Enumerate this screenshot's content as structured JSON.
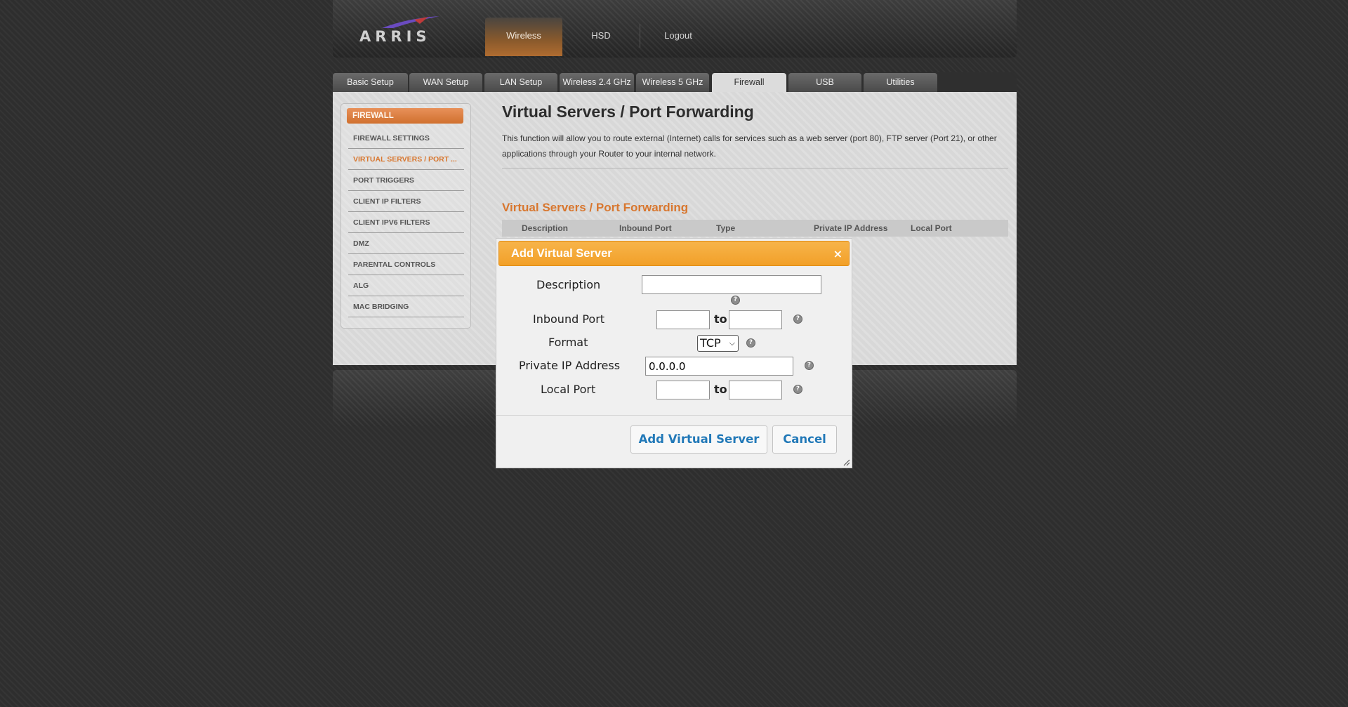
{
  "header": {
    "logo_text": "ARRIS",
    "nav": [
      {
        "label": "Wireless",
        "active": true
      },
      {
        "label": "HSD",
        "active": false
      },
      {
        "label": "Logout",
        "active": false
      }
    ]
  },
  "tabs": [
    {
      "label": "Basic Setup"
    },
    {
      "label": "WAN Setup"
    },
    {
      "label": "LAN Setup"
    },
    {
      "label": "Wireless 2.4 GHz"
    },
    {
      "label": "Wireless 5 GHz"
    },
    {
      "label": "Firewall",
      "active": true
    },
    {
      "label": "USB"
    },
    {
      "label": "Utilities"
    }
  ],
  "sidebar": {
    "header": "FIREWALL",
    "items": [
      {
        "label": "FIREWALL SETTINGS"
      },
      {
        "label": "VIRTUAL SERVERS / PORT ...",
        "active": true
      },
      {
        "label": "PORT TRIGGERS"
      },
      {
        "label": "CLIENT IP FILTERS"
      },
      {
        "label": "CLIENT IPV6 FILTERS"
      },
      {
        "label": "DMZ"
      },
      {
        "label": "PARENTAL CONTROLS"
      },
      {
        "label": "ALG"
      },
      {
        "label": "MAC BRIDGING"
      }
    ]
  },
  "content": {
    "title": "Virtual Servers / Port Forwarding",
    "description": "This function will allow you to route external (Internet) calls for services such as a web server (port 80), FTP server (Port 21), or other applications through your Router to your internal network.",
    "section_title": "Virtual Servers / Port Forwarding",
    "table_headers": [
      "Description",
      "Inbound Port",
      "Type",
      "Private IP Address",
      "Local Port"
    ]
  },
  "dialog": {
    "title": "Add Virtual Server",
    "close_glyph": "×",
    "help_glyph": "?",
    "description_label": "Description",
    "description_value": "",
    "inbound_port_label": "Inbound Port",
    "inbound_port_from": "",
    "inbound_port_to": "",
    "to_label": "to",
    "format_label": "Format",
    "format_value": "TCP",
    "private_ip_label": "Private IP Address",
    "private_ip_value": "0.0.0.0",
    "local_port_label": "Local Port",
    "local_port_from": "",
    "local_port_to": "",
    "add_button": "Add Virtual Server",
    "cancel_button": "Cancel"
  },
  "colors": {
    "accent_orange": "#f2a028",
    "sidebar_header": "#d8772f",
    "link_blue": "#2279b8"
  }
}
